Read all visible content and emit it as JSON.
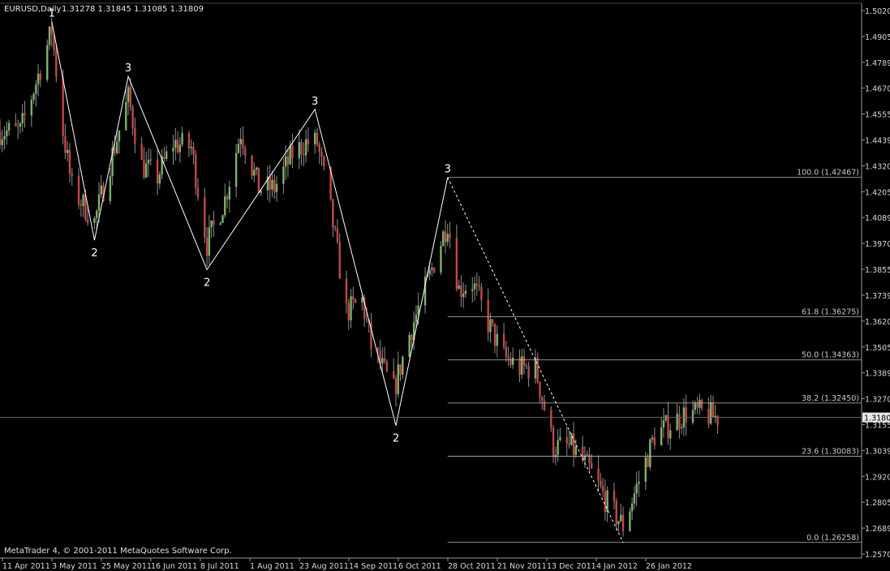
{
  "header": {
    "symbol": "EURUSD,Daily",
    "ohlc": "1.31278 1.31845 1.31085 1.31809"
  },
  "footer": {
    "copyright": "MetaTrader 4, © 2001-2011 MetaQuotes Software Corp."
  },
  "colors": {
    "background": "#000000",
    "bull_candle": "#7fb26b",
    "bear_candle": "#c44848",
    "wick": "#8f8f8f",
    "wave_line": "#ffffff",
    "fib_line": "#bdbdbd",
    "axis": "#9a9a9a",
    "price_tag_bg": "#e8e8e8",
    "price_tag_text": "#000000"
  },
  "chart_data": {
    "type": "candlestick",
    "symbol": "EURUSD",
    "timeframe": "Daily",
    "x_ticks": [
      "11 Apr 2011",
      "3 May 2011",
      "25 May 2011",
      "16 Jun 2011",
      "8 Jul 2011",
      "1 Aug 2011",
      "23 Aug 2011",
      "14 Sep 2011",
      "6 Oct 2011",
      "28 Oct 2011",
      "21 Nov 2011",
      "13 Dec 2011",
      "4 Jan 2012",
      "26 Jan 2012"
    ],
    "y_ticks": [
      "1.50205",
      "1.49050",
      "1.47895",
      "1.46705",
      "1.45550",
      "1.44395",
      "1.43205",
      "1.42050",
      "1.40895",
      "1.39705",
      "1.38550",
      "1.37395",
      "1.36205",
      "1.35050",
      "1.33895",
      "1.32705",
      "1.31550",
      "1.30395",
      "1.29205",
      "1.28050",
      "1.26895",
      "1.25705"
    ],
    "ylim": [
      1.2571,
      1.502
    ],
    "current_price": "1.31809",
    "wave_points": [
      {
        "label": "1",
        "date": "2011-05-04",
        "price": 1.4939
      },
      {
        "label": "2",
        "date": "2011-05-23",
        "price": 1.3968
      },
      {
        "label": "3",
        "date": "2011-06-07",
        "price": 1.4695
      },
      {
        "label": "2",
        "date": "2011-07-12",
        "price": 1.3837
      },
      {
        "label": "3",
        "date": "2011-08-29",
        "price": 1.4549
      },
      {
        "label": "2",
        "date": "2011-10-04",
        "price": 1.3145
      },
      {
        "label": "3",
        "date": "2011-10-27",
        "price": 1.4247
      },
      {
        "label": "",
        "date": "2012-01-13",
        "price": 1.2626
      }
    ],
    "fib_levels": [
      {
        "label": "100.0 (1.42467)",
        "price": 1.42467
      },
      {
        "label": "61.8 (1.36275)",
        "price": 1.36275
      },
      {
        "label": "50.0 (1.34363)",
        "price": 1.34363
      },
      {
        "label": "38.2 (1.32450)",
        "price": 1.3245
      },
      {
        "label": "23.6 (1.30083)",
        "price": 1.30083
      },
      {
        "label": "0.0 (1.26258)",
        "price": 1.26258
      }
    ],
    "trend_path": [
      [
        "2011-04-11",
        1.445
      ],
      [
        "2011-04-20",
        1.445
      ],
      [
        "2011-04-28",
        1.47
      ],
      [
        "2011-05-04",
        1.49
      ],
      [
        "2011-05-09",
        1.445
      ],
      [
        "2011-05-13",
        1.42
      ],
      [
        "2011-05-23",
        1.405
      ],
      [
        "2011-05-31",
        1.435
      ],
      [
        "2011-06-07",
        1.46
      ],
      [
        "2011-06-13",
        1.43
      ],
      [
        "2011-06-20",
        1.425
      ],
      [
        "2011-06-27",
        1.44
      ],
      [
        "2011-07-05",
        1.438
      ],
      [
        "2011-07-12",
        1.395
      ],
      [
        "2011-07-20",
        1.415
      ],
      [
        "2011-07-27",
        1.445
      ],
      [
        "2011-08-04",
        1.42
      ],
      [
        "2011-08-11",
        1.42
      ],
      [
        "2011-08-19",
        1.435
      ],
      [
        "2011-08-25",
        1.44
      ],
      [
        "2011-08-30",
        1.44
      ],
      [
        "2011-09-05",
        1.41
      ],
      [
        "2011-09-12",
        1.365
      ],
      [
        "2011-09-19",
        1.37
      ],
      [
        "2011-09-23",
        1.35
      ],
      [
        "2011-10-03",
        1.33
      ],
      [
        "2011-10-10",
        1.355
      ],
      [
        "2011-10-17",
        1.375
      ],
      [
        "2011-10-27",
        1.405
      ],
      [
        "2011-11-01",
        1.375
      ],
      [
        "2011-11-07",
        1.378
      ],
      [
        "2011-11-14",
        1.36
      ],
      [
        "2011-11-21",
        1.345
      ],
      [
        "2011-11-28",
        1.34
      ],
      [
        "2011-12-05",
        1.34
      ],
      [
        "2011-12-13",
        1.305
      ],
      [
        "2011-12-21",
        1.305
      ],
      [
        "2011-12-29",
        1.295
      ],
      [
        "2012-01-06",
        1.28
      ],
      [
        "2012-01-13",
        1.27
      ],
      [
        "2012-01-20",
        1.29
      ],
      [
        "2012-01-27",
        1.31
      ],
      [
        "2012-02-03",
        1.315
      ],
      [
        "2012-02-10",
        1.32
      ],
      [
        "2012-02-17",
        1.32
      ],
      [
        "2012-02-24",
        1.318
      ]
    ]
  }
}
